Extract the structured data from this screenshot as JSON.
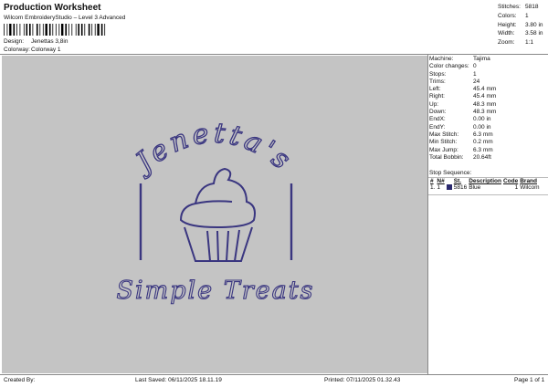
{
  "header": {
    "title": "Production Worksheet",
    "software": "Wilcom EmbroideryStudio – Level 3 Advanced",
    "design_label": "Design:",
    "design_value": "Jenettas 3,8in",
    "colorway_label": "Colorway:",
    "colorway_value": "Colorway 1"
  },
  "stats": [
    {
      "label": "Stitches:",
      "value": "5818"
    },
    {
      "label": "Colors:",
      "value": "1"
    },
    {
      "label": "Height:",
      "value": "3.80 in"
    },
    {
      "label": "Width:",
      "value": "3.58 in"
    },
    {
      "label": "Zoom:",
      "value": "1:1"
    }
  ],
  "design": {
    "line1": "Jenetta's",
    "line2": "Simple Treats",
    "thread_color": "#3a3680",
    "background": "#c4c4c4"
  },
  "machine_info": [
    {
      "label": "Machine:",
      "value": "Tajima"
    },
    {
      "label": "Color changes:",
      "value": "0"
    },
    {
      "label": "Stops:",
      "value": "1"
    },
    {
      "label": "Trims:",
      "value": "24"
    },
    {
      "label": "Left:",
      "value": "45.4 mm"
    },
    {
      "label": "Right:",
      "value": "45.4 mm"
    },
    {
      "label": "Up:",
      "value": "48.3 mm"
    },
    {
      "label": "Down:",
      "value": "48.3 mm"
    },
    {
      "label": "EndX:",
      "value": "0.00 in"
    },
    {
      "label": "EndY:",
      "value": "0.00 in"
    },
    {
      "label": "Max Stitch:",
      "value": "6.3 mm"
    },
    {
      "label": "Min Stitch:",
      "value": "0.2 mm"
    },
    {
      "label": "Max Jump:",
      "value": "6.3 mm"
    },
    {
      "label": "Total Bobbin:",
      "value": "20.64ft"
    }
  ],
  "stop_sequence": {
    "heading": "Stop Sequence:",
    "columns": [
      "#",
      "N#",
      "St.",
      "Description",
      "Code",
      "Brand"
    ],
    "rows": [
      {
        "num": "1.",
        "n": "1",
        "swatch": "#2b2a6e",
        "st": "5816",
        "description": "Blue",
        "code": "1",
        "brand": "Wilcom"
      }
    ]
  },
  "footer": {
    "created_by": "Created By:",
    "last_saved": "Last Saved: 06/11/2025 18.11.19",
    "printed": "Printed: 07/11/2025 01.32.43",
    "page": "Page 1 of 1"
  }
}
